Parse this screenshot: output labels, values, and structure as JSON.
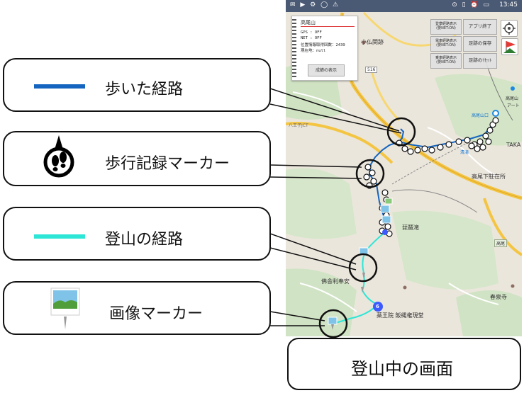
{
  "legend": {
    "walked_route_label": "歩いた経路",
    "walk_marker_label": "歩行記録マーカー",
    "climb_route_label": "登山の経路",
    "image_marker_label": "画像マーカー"
  },
  "screen_caption": "登山中の画面",
  "colors": {
    "walked_route": "#1565c0",
    "climb_route": "#2ee6d6",
    "flag_red": "#e53935",
    "flag_green": "#2e7d32",
    "cluster": "#3d5afe"
  },
  "statusbar": {
    "left_icons": "✉ ▶ ⚙ ◯ ⚠",
    "right_icons": "⊙ ▯ ⏰ ▭",
    "time": "13:45"
  },
  "info_panel": {
    "mountain": "高尾山",
    "gps": "GPS : OFF",
    "net": "NET : OFF",
    "location_count": "位置情報取得回数：2439",
    "current": "現在地：null",
    "result_button": "成績の表示"
  },
  "map_buttons": {
    "b1": "登攀経路表示\n(要NET:ON)",
    "b2": "アプリ終了",
    "b3": "電車経路表示\n(要NET:ON)",
    "b4": "足跡の保存",
    "b5": "乗車経路表示\n(要NET:ON)",
    "b6": "足跡のﾘｾｯﾄ"
  },
  "map_icons": {
    "locate": "crosshair-icon",
    "flag": "flag-icon"
  },
  "map_labels": {
    "kobotoke": "小仏関跡",
    "route516": "516",
    "hachioji_jct": "八王子JCT",
    "takaosan_station": "高尾山口",
    "takao": "TAKA",
    "takao_shita": "高尾下駐在所",
    "biwa": "琵琶滝",
    "bussha": "佛舎利奉安",
    "ikiin": "薬王院 飯縄権現堂",
    "shunsenji": "春泉寺",
    "takao_right": "高尾山",
    "takao_top": "高尾山",
    "arts": "アート",
    "kiyotaki": "清滝",
    "takao_mark": "高尾",
    "cluster_count": "6"
  }
}
